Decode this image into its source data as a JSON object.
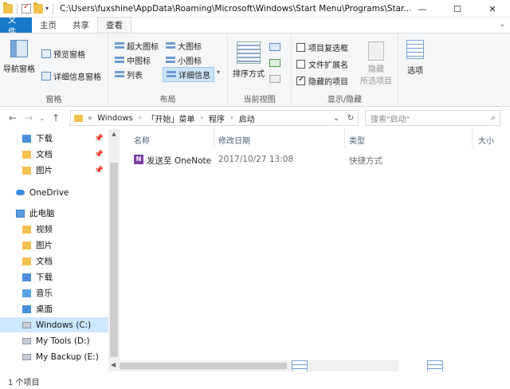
{
  "titlebar": {
    "path": "C:\\Users\\fuxshine\\AppData\\Roaming\\Microsoft\\Windows\\Start Menu\\Programs\\Star...",
    "minimize": "—",
    "maximize": "☐",
    "close": "✕"
  },
  "tabs": {
    "file": "文件",
    "home": "主页",
    "share": "共享",
    "view": "查看"
  },
  "ribbon": {
    "panes": {
      "label": "窗格",
      "nav_pane": "导航窗格",
      "preview_pane": "预览窗格",
      "details_pane": "详细信息窗格"
    },
    "layout": {
      "label": "布局",
      "extra_large": "超大图标",
      "large": "大图标",
      "medium": "中图标",
      "small": "小图标",
      "list": "列表",
      "details": "详细信息"
    },
    "current_view": {
      "label": "当前视图",
      "sort_by": "排序方式"
    },
    "show_hide": {
      "label": "显示/隐藏",
      "item_checkboxes": "项目复选框",
      "file_extensions": "文件扩展名",
      "hidden_items": "隐藏的项目",
      "hide_selected_line1": "隐藏",
      "hide_selected_line2": "所选项目"
    },
    "options": "选项"
  },
  "address": {
    "prefix": "«",
    "crumbs": [
      "Windows",
      "「开始」菜单",
      "程序",
      "启动"
    ],
    "search_placeholder": "搜索\"启动\""
  },
  "navpane": [
    {
      "label": "下载",
      "icon": "downloads-icon",
      "pinned": true
    },
    {
      "label": "文档",
      "icon": "folder-icon",
      "pinned": true
    },
    {
      "label": "图片",
      "icon": "folder-icon",
      "pinned": true
    },
    {
      "label": "OneDrive",
      "icon": "onedrive-icon",
      "pinned": false
    },
    {
      "label": "此电脑",
      "icon": "this-pc-icon",
      "pinned": false
    },
    {
      "label": "视频",
      "icon": "folder-icon",
      "pinned": false
    },
    {
      "label": "图片",
      "icon": "folder-icon",
      "pinned": false
    },
    {
      "label": "文档",
      "icon": "folder-icon",
      "pinned": false
    },
    {
      "label": "下载",
      "icon": "downloads-icon",
      "pinned": false
    },
    {
      "label": "音乐",
      "icon": "music-icon",
      "pinned": false
    },
    {
      "label": "桌面",
      "icon": "desktop-icon",
      "pinned": false
    },
    {
      "label": "Windows (C:)",
      "icon": "drive-icon",
      "pinned": false
    },
    {
      "label": "My Tools (D:)",
      "icon": "drive-icon",
      "pinned": false
    },
    {
      "label": "My Backup (E:)",
      "icon": "drive-icon",
      "pinned": false
    }
  ],
  "columns": {
    "name": "名称",
    "modified": "修改日期",
    "type": "类型",
    "size": "大小"
  },
  "files": [
    {
      "name": "发送至 OneNote",
      "modified": "2017/10/27 13:08",
      "type": "快捷方式"
    }
  ],
  "status": {
    "count": "1 个项目"
  },
  "ghost_options": "选项"
}
